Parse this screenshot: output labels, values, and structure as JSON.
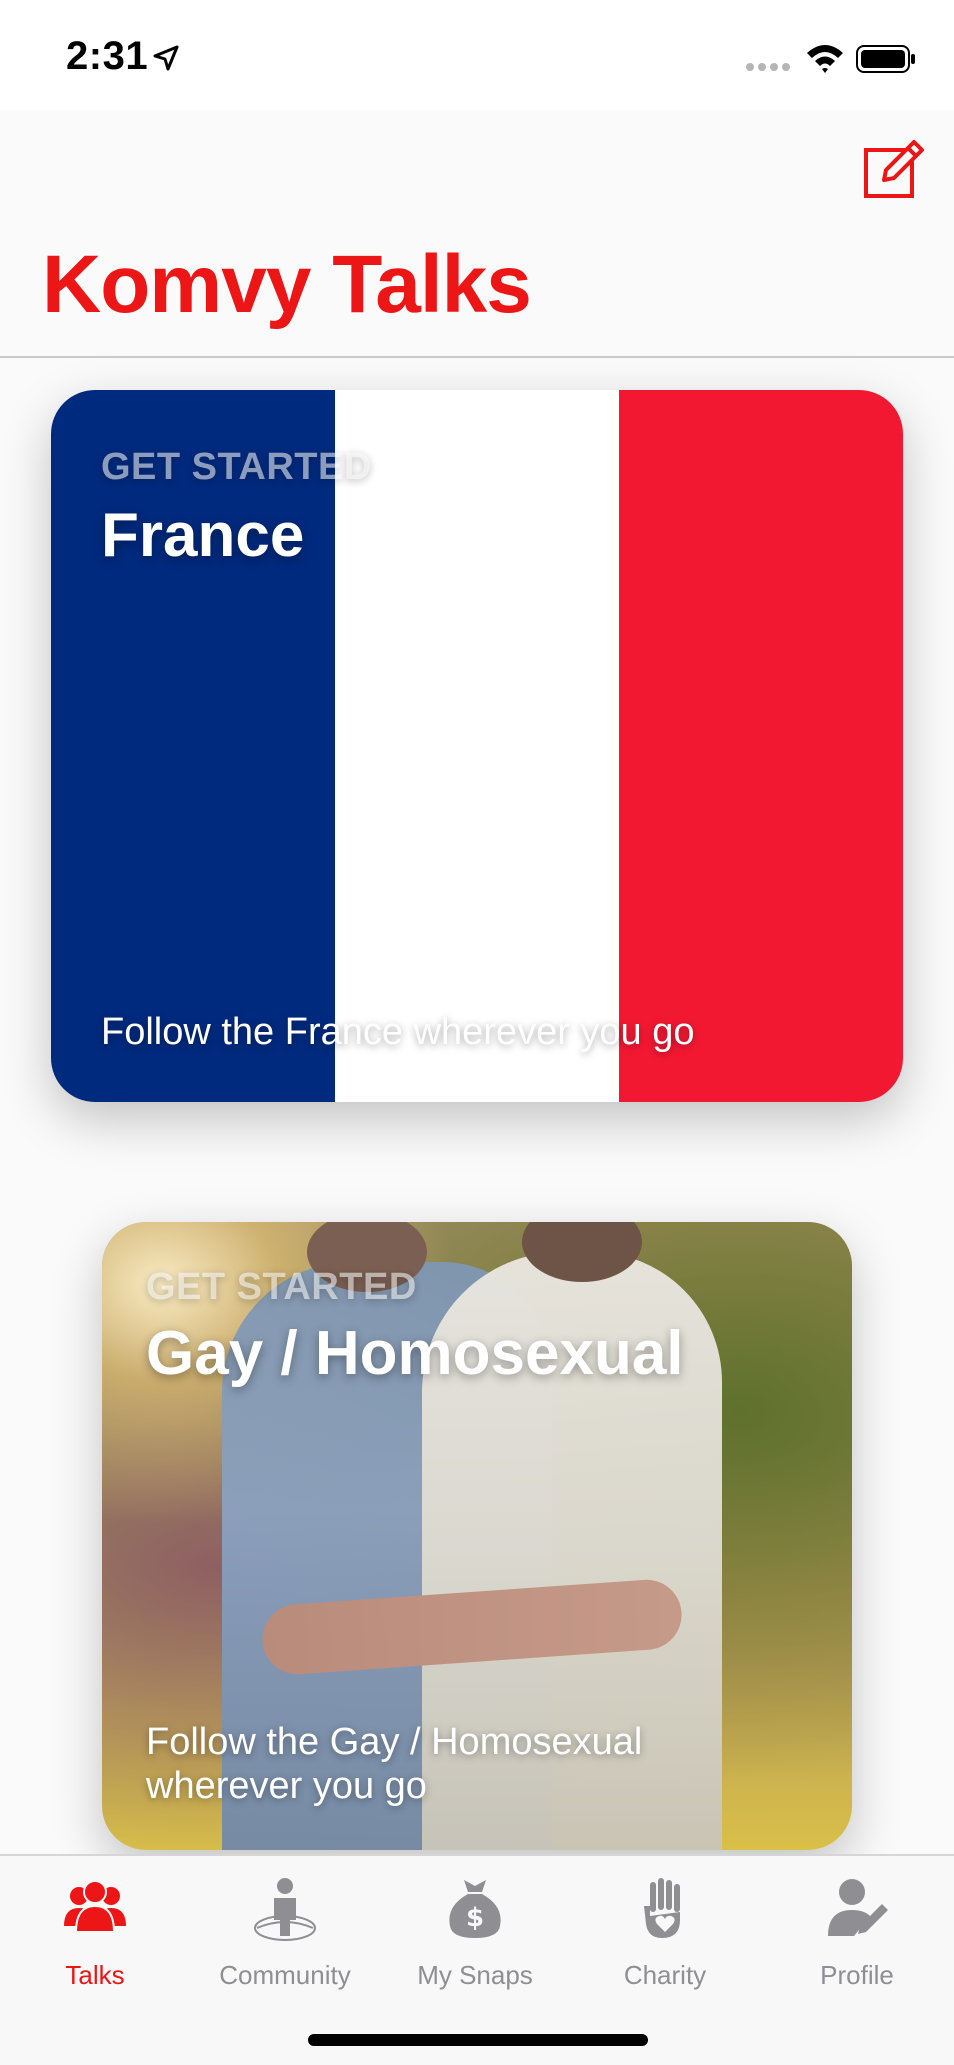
{
  "status_bar": {
    "time": "2:31"
  },
  "header": {
    "title": "Komvy Talks",
    "title_color": "#ec1616",
    "compose_icon": "compose-icon"
  },
  "cards": [
    {
      "kicker": "GET STARTED",
      "title": "France",
      "caption": "Follow the France wherever you go",
      "flag_colors": [
        "#002a7e",
        "#ffffff",
        "#f31832"
      ]
    },
    {
      "kicker": "GET STARTED",
      "title": "Gay / Homosexual",
      "caption": "Follow the Gay / Homosexual wherever you go"
    }
  ],
  "tabs": [
    {
      "label": "Talks",
      "icon": "group-icon",
      "active": true
    },
    {
      "label": "Community",
      "icon": "globe-person-icon",
      "active": false
    },
    {
      "label": "My Snaps",
      "icon": "money-bag-icon",
      "active": false
    },
    {
      "label": "Charity",
      "icon": "heart-hand-icon",
      "active": false
    },
    {
      "label": "Profile",
      "icon": "person-pencil-icon",
      "active": false
    }
  ],
  "colors": {
    "accent": "#ec1616",
    "inactive_tab": "#8e8e93"
  }
}
